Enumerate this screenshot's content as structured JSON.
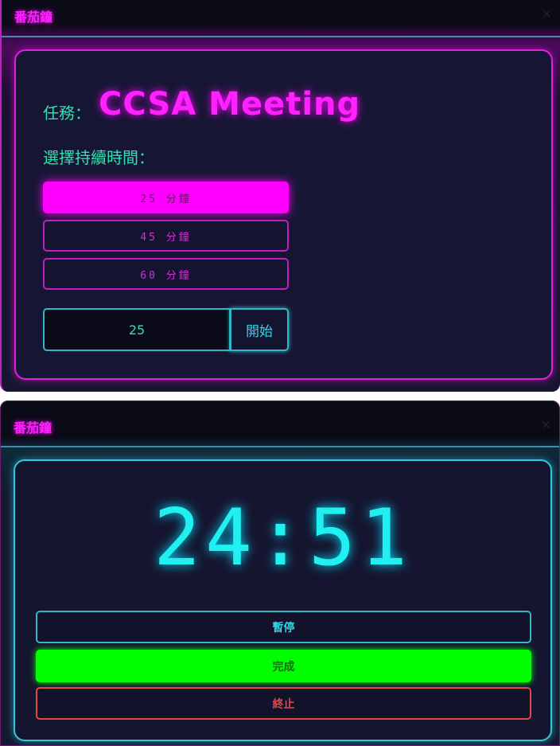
{
  "setup_window": {
    "title": "番茄鐘",
    "close_icon": "close-icon",
    "task_label": "任務：",
    "task_name": "CCSA Meeting",
    "duration_label": "選擇持續時間：",
    "durations": [
      {
        "label": "25 分鐘",
        "selected": true
      },
      {
        "label": "45 分鐘",
        "selected": false
      },
      {
        "label": "60 分鐘",
        "selected": false
      }
    ],
    "minutes_value": "25",
    "start_label": "開始"
  },
  "timer_window": {
    "title": "番茄鐘",
    "close_icon": "close-icon",
    "time": "24:51",
    "pause_label": "暫停",
    "done_label": "完成",
    "stop_label": "終止"
  },
  "colors": {
    "magenta": "#ff00ff",
    "cyan": "#20f0f0",
    "green": "#00ff00",
    "red": "#e04848",
    "teal": "#30e0b0"
  }
}
